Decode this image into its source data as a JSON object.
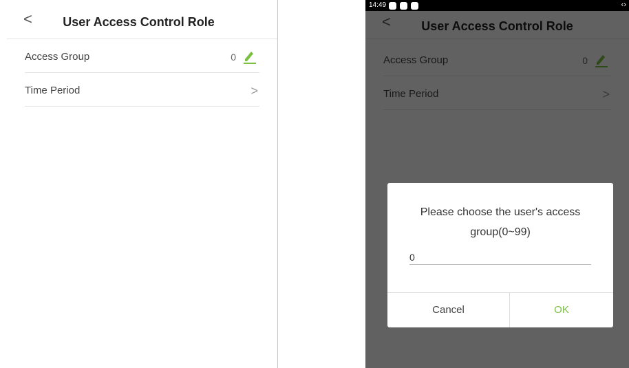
{
  "screen": {
    "title": "User Access Control Role",
    "back_glyph": "<",
    "rows": [
      {
        "label": "Access Group",
        "value": "0",
        "action_icon": "pencil-icon"
      },
      {
        "label": "Time Period",
        "action_icon": "chevron-right-icon",
        "chevron": ">"
      }
    ]
  },
  "device": {
    "status_time": "14:49",
    "status_right": "‹›",
    "dialog": {
      "message": "Please choose the user's access group(0~99)",
      "input_value": "0",
      "cancel_label": "Cancel",
      "ok_label": "OK"
    }
  },
  "colors": {
    "accent": "#7cc043",
    "overlay": "#000000"
  }
}
